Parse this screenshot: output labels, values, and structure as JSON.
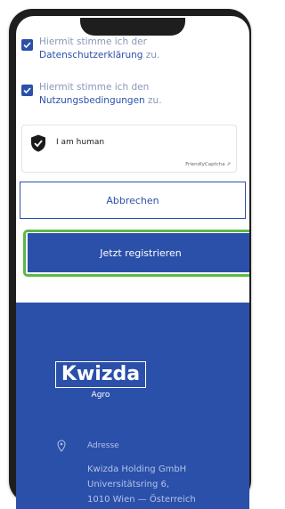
{
  "consent": {
    "privacy": {
      "text_before": "Hiermit stimme ich der",
      "link": "Datenschutzerklärung",
      "text_after": " zu."
    },
    "terms": {
      "text_before": "Hiermit stimme ich den",
      "link": "Nutzungsbedingungen",
      "text_after": " zu."
    }
  },
  "captcha": {
    "label": "I am human",
    "brand": "FriendlyCaptcha ⇗"
  },
  "buttons": {
    "cancel": "Abbrechen",
    "submit": "Jetzt registrieren"
  },
  "footer": {
    "logo": "Kwizda",
    "logo_sub": "Agro",
    "address_label": "Adresse",
    "address_lines": [
      "Kwizda Holding GmbH",
      "Universitätsring 6,",
      "1010 Wien — Österreich"
    ]
  },
  "colors": {
    "brand_blue": "#2b50aa",
    "focus_green": "#5cb846"
  }
}
